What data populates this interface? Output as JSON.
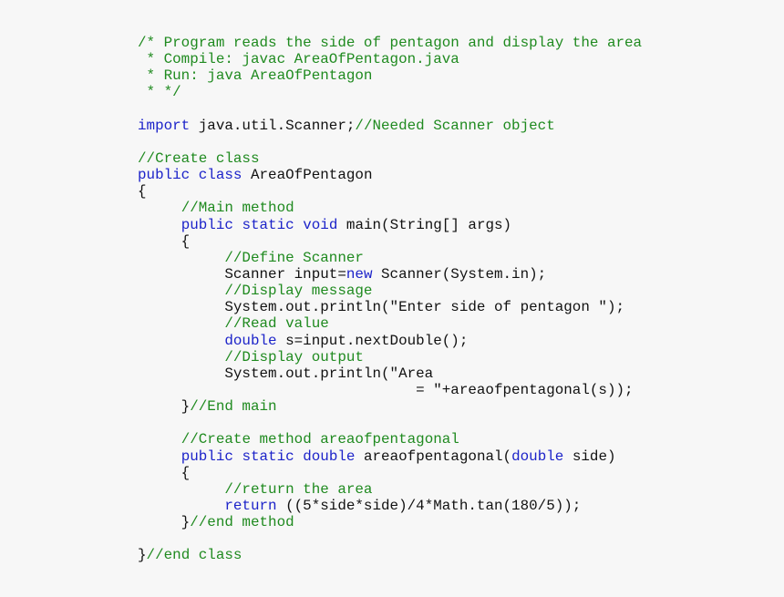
{
  "document": {
    "language": "java",
    "colors": {
      "background": "#f7f7f7",
      "comment": "#1f8a1f",
      "keyword": "#1c23c9",
      "plain": "#111111"
    },
    "lines": [
      [
        {
          "t": "comment",
          "v": "/* Program reads the side of pentagon and display the area"
        }
      ],
      [
        {
          "t": "comment",
          "v": " * Compile: javac AreaOfPentagon.java"
        }
      ],
      [
        {
          "t": "comment",
          "v": " * Run: java AreaOfPentagon"
        }
      ],
      [
        {
          "t": "comment",
          "v": " * */"
        }
      ],
      [],
      [
        {
          "t": "keyword",
          "v": "import"
        },
        {
          "t": "plain",
          "v": " java.util.Scanner;"
        },
        {
          "t": "comment",
          "v": "//Needed Scanner object"
        }
      ],
      [],
      [
        {
          "t": "comment",
          "v": "//Create class"
        }
      ],
      [
        {
          "t": "keyword",
          "v": "public"
        },
        {
          "t": "plain",
          "v": " "
        },
        {
          "t": "keyword",
          "v": "class"
        },
        {
          "t": "plain",
          "v": " AreaOfPentagon"
        }
      ],
      [
        {
          "t": "plain",
          "v": "{"
        }
      ],
      [
        {
          "t": "plain",
          "v": "     "
        },
        {
          "t": "comment",
          "v": "//Main method"
        }
      ],
      [
        {
          "t": "plain",
          "v": "     "
        },
        {
          "t": "keyword",
          "v": "public"
        },
        {
          "t": "plain",
          "v": " "
        },
        {
          "t": "keyword",
          "v": "static"
        },
        {
          "t": "plain",
          "v": " "
        },
        {
          "t": "keyword",
          "v": "void"
        },
        {
          "t": "plain",
          "v": " main(String[] args)"
        }
      ],
      [
        {
          "t": "plain",
          "v": "     {"
        }
      ],
      [
        {
          "t": "plain",
          "v": "          "
        },
        {
          "t": "comment",
          "v": "//Define Scanner"
        }
      ],
      [
        {
          "t": "plain",
          "v": "          Scanner input="
        },
        {
          "t": "keyword",
          "v": "new"
        },
        {
          "t": "plain",
          "v": " Scanner(System.in);"
        }
      ],
      [
        {
          "t": "plain",
          "v": "          "
        },
        {
          "t": "comment",
          "v": "//Display message"
        }
      ],
      [
        {
          "t": "plain",
          "v": "          System.out.println(\"Enter side of pentagon \");"
        }
      ],
      [
        {
          "t": "plain",
          "v": "          "
        },
        {
          "t": "comment",
          "v": "//Read value"
        }
      ],
      [
        {
          "t": "plain",
          "v": "          "
        },
        {
          "t": "keyword",
          "v": "double"
        },
        {
          "t": "plain",
          "v": " s=input.nextDouble();"
        }
      ],
      [
        {
          "t": "plain",
          "v": "          "
        },
        {
          "t": "comment",
          "v": "//Display output"
        }
      ],
      [
        {
          "t": "plain",
          "v": "          System.out.println(\"Area"
        }
      ],
      [
        {
          "t": "plain",
          "v": "                                = \"+areaofpentagonal(s));"
        }
      ],
      [
        {
          "t": "plain",
          "v": "     }"
        },
        {
          "t": "comment",
          "v": "//End main"
        }
      ],
      [],
      [
        {
          "t": "plain",
          "v": "     "
        },
        {
          "t": "comment",
          "v": "//Create method areaofpentagonal"
        }
      ],
      [
        {
          "t": "plain",
          "v": "     "
        },
        {
          "t": "keyword",
          "v": "public"
        },
        {
          "t": "plain",
          "v": " "
        },
        {
          "t": "keyword",
          "v": "static"
        },
        {
          "t": "plain",
          "v": " "
        },
        {
          "t": "keyword",
          "v": "double"
        },
        {
          "t": "plain",
          "v": " areaofpentagonal("
        },
        {
          "t": "keyword",
          "v": "double"
        },
        {
          "t": "plain",
          "v": " side)"
        }
      ],
      [
        {
          "t": "plain",
          "v": "     {"
        }
      ],
      [
        {
          "t": "plain",
          "v": "          "
        },
        {
          "t": "comment",
          "v": "//return the area"
        }
      ],
      [
        {
          "t": "plain",
          "v": "          "
        },
        {
          "t": "keyword",
          "v": "return"
        },
        {
          "t": "plain",
          "v": " ((5*side*side)/4*Math.tan(180/5));"
        }
      ],
      [
        {
          "t": "plain",
          "v": "     }"
        },
        {
          "t": "comment",
          "v": "//end method"
        }
      ],
      [],
      [
        {
          "t": "plain",
          "v": "}"
        },
        {
          "t": "comment",
          "v": "//end class"
        }
      ]
    ]
  }
}
